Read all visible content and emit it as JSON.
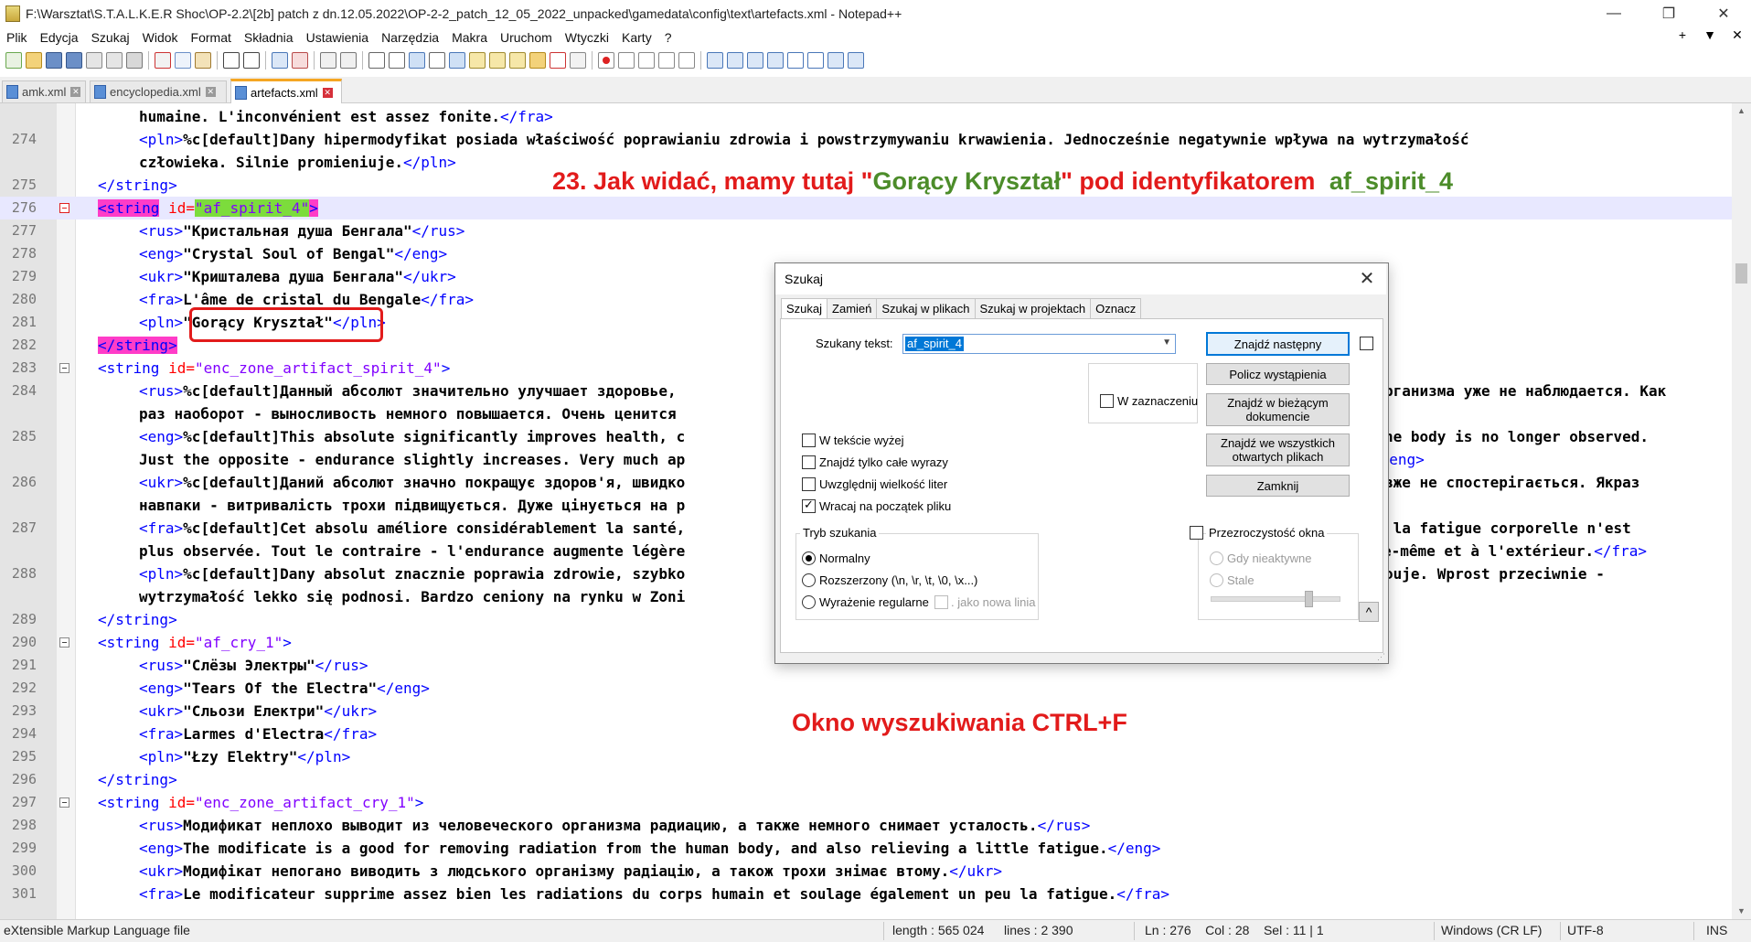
{
  "window": {
    "title": "F:\\Warsztat\\S.T.A.L.K.E.R Shoc\\OP-2.2\\[2b] patch z dn.12.05.2022\\OP-2-2_patch_12_05_2022_unpacked\\gamedata\\config\\text\\artefacts.xml - Notepad++",
    "minimize": "—",
    "maximize": "❐",
    "close": "✕"
  },
  "menu": {
    "items": [
      "Plik",
      "Edycja",
      "Szukaj",
      "Widok",
      "Format",
      "Składnia",
      "Ustawienia",
      "Narzędzia",
      "Makra",
      "Uruchom",
      "Wtyczki",
      "Karty",
      "?"
    ],
    "right": [
      "+",
      "▼",
      "✕"
    ]
  },
  "tabs": [
    {
      "label": "amk.xml",
      "active": false
    },
    {
      "label": "encyclopedia.xml",
      "active": false
    },
    {
      "label": "artefacts.xml",
      "active": true
    }
  ],
  "editor": {
    "lines": [
      {
        "n": "",
        "indent": 2,
        "parts": [
          [
            "txt",
            "humaine. L'inconvénient est assez fonite."
          ],
          [
            "tg",
            "</fra>"
          ]
        ]
      },
      {
        "n": "274",
        "indent": 2,
        "parts": [
          [
            "tg",
            "<pln>"
          ],
          [
            "txt",
            "%c[default]Dany hipermodyfikat posiada właściwość poprawianiu zdrowia i powstrzymywaniu krwawienia. Jednocześnie negatywnie wpływa na wytrzymałość"
          ]
        ]
      },
      {
        "n": "",
        "indent": 2,
        "parts": [
          [
            "txt",
            "człowieka. Silnie promieniuje."
          ],
          [
            "tg",
            "</pln>"
          ]
        ]
      },
      {
        "n": "275",
        "indent": 1,
        "parts": [
          [
            "tg",
            "</string>"
          ]
        ]
      },
      {
        "n": "276",
        "indent": 1,
        "hl": true,
        "parts": [
          [
            "tgx",
            "<string"
          ],
          [
            "at",
            " id="
          ],
          [
            "avx",
            "\"af_spirit_4\""
          ],
          [
            "tgx",
            ">"
          ]
        ]
      },
      {
        "n": "277",
        "indent": 2,
        "parts": [
          [
            "tg",
            "<rus>"
          ],
          [
            "txt",
            "\"Кристальная душа Бенгала\""
          ],
          [
            "tg",
            "</rus>"
          ]
        ]
      },
      {
        "n": "278",
        "indent": 2,
        "parts": [
          [
            "tg",
            "<eng>"
          ],
          [
            "txt",
            "\"Crystal Soul of Bengal\""
          ],
          [
            "tg",
            "</eng>"
          ]
        ]
      },
      {
        "n": "279",
        "indent": 2,
        "parts": [
          [
            "tg",
            "<ukr>"
          ],
          [
            "txt",
            "\"Кришталева душа Бенгала\""
          ],
          [
            "tg",
            "</ukr>"
          ]
        ]
      },
      {
        "n": "280",
        "indent": 2,
        "parts": [
          [
            "tg",
            "<fra>"
          ],
          [
            "txt",
            "L'âme de cristal du Bengale"
          ],
          [
            "tg",
            "</fra>"
          ]
        ]
      },
      {
        "n": "281",
        "indent": 2,
        "parts": [
          [
            "tg",
            "<pln>"
          ],
          [
            "txt",
            "\"Gorący Kryształ\""
          ],
          [
            "tg",
            "</pln>"
          ]
        ]
      },
      {
        "n": "282",
        "indent": 1,
        "parts": [
          [
            "tgx",
            "</string>"
          ]
        ]
      },
      {
        "n": "283",
        "indent": 1,
        "parts": [
          [
            "tg",
            "<string"
          ],
          [
            "at",
            " id="
          ],
          [
            "av",
            "\"enc_zone_artifact_spirit_4\""
          ],
          [
            "tg",
            ">"
          ]
        ]
      },
      {
        "n": "284",
        "indent": 2,
        "parts": [
          [
            "tg",
            "<rus>"
          ],
          [
            "txt",
            "%c[default]Данный абсолют значительно улучшает здоровье,"
          ]
        ]
      },
      {
        "n": "",
        "indent": 2,
        "parts": [
          [
            "txt",
            "раз наоборот - выносливость немного повышается. Очень ценится"
          ]
        ]
      },
      {
        "n": "285",
        "indent": 2,
        "parts": [
          [
            "tg",
            "<eng>"
          ],
          [
            "txt",
            "%c[default]This absolute significantly improves health, c"
          ]
        ]
      },
      {
        "n": "",
        "indent": 2,
        "parts": [
          [
            "txt",
            "Just the opposite - endurance slightly increases. Very much ap"
          ]
        ]
      },
      {
        "n": "286",
        "indent": 2,
        "parts": [
          [
            "tg",
            "<ukr>"
          ],
          [
            "txt",
            "%c[default]Даний абсолют значно покращує здоров'я, швидко"
          ]
        ]
      },
      {
        "n": "",
        "indent": 2,
        "parts": [
          [
            "txt",
            "навпаки - витривалість трохи підвищується. Дуже цінується на р"
          ]
        ]
      },
      {
        "n": "287",
        "indent": 2,
        "parts": [
          [
            "tg",
            "<fra>"
          ],
          [
            "txt",
            "%c[default]Cet absolu améliore considérablement la santé,"
          ]
        ]
      },
      {
        "n": "",
        "indent": 2,
        "parts": [
          [
            "txt",
            "plus observée. Tout le contraire - l'endurance augmente légère"
          ]
        ]
      },
      {
        "n": "288",
        "indent": 2,
        "parts": [
          [
            "tg",
            "<pln>"
          ],
          [
            "txt",
            "%c[default]Dany absolut znacznie poprawia zdrowie, szybko"
          ]
        ]
      },
      {
        "n": "",
        "indent": 2,
        "parts": [
          [
            "txt",
            "wytrzymałość lekko się podnosi. Bardzo ceniony na rynku w Zoni"
          ]
        ]
      },
      {
        "n": "289",
        "indent": 1,
        "parts": [
          [
            "tg",
            "</string>"
          ]
        ]
      },
      {
        "n": "290",
        "indent": 1,
        "parts": [
          [
            "tg",
            "<string"
          ],
          [
            "at",
            " id="
          ],
          [
            "av",
            "\"af_cry_1\""
          ],
          [
            "tg",
            ">"
          ]
        ]
      },
      {
        "n": "291",
        "indent": 2,
        "parts": [
          [
            "tg",
            "<rus>"
          ],
          [
            "txt",
            "\"Слёзы Электры\""
          ],
          [
            "tg",
            "</rus>"
          ]
        ]
      },
      {
        "n": "292",
        "indent": 2,
        "parts": [
          [
            "tg",
            "<eng>"
          ],
          [
            "txt",
            "\"Tears Of the Electra\""
          ],
          [
            "tg",
            "</eng>"
          ]
        ]
      },
      {
        "n": "293",
        "indent": 2,
        "parts": [
          [
            "tg",
            "<ukr>"
          ],
          [
            "txt",
            "\"Сльози Електри\""
          ],
          [
            "tg",
            "</ukr>"
          ]
        ]
      },
      {
        "n": "294",
        "indent": 2,
        "parts": [
          [
            "tg",
            "<fra>"
          ],
          [
            "txt",
            "Larmes d'Electra"
          ],
          [
            "tg",
            "</fra>"
          ]
        ]
      },
      {
        "n": "295",
        "indent": 2,
        "parts": [
          [
            "tg",
            "<pln>"
          ],
          [
            "txt",
            "\"Łzy Elektry\""
          ],
          [
            "tg",
            "</pln>"
          ]
        ]
      },
      {
        "n": "296",
        "indent": 1,
        "parts": [
          [
            "tg",
            "</string>"
          ]
        ]
      },
      {
        "n": "297",
        "indent": 1,
        "parts": [
          [
            "tg",
            "<string"
          ],
          [
            "at",
            " id="
          ],
          [
            "av",
            "\"enc_zone_artifact_cry_1\""
          ],
          [
            "tg",
            ">"
          ]
        ]
      },
      {
        "n": "298",
        "indent": 2,
        "parts": [
          [
            "tg",
            "<rus>"
          ],
          [
            "txt",
            "Модификат неплохо выводит из человеческого организма радиацию, а также немного снимает усталость."
          ],
          [
            "tg",
            "</rus>"
          ]
        ]
      },
      {
        "n": "299",
        "indent": 2,
        "parts": [
          [
            "tg",
            "<eng>"
          ],
          [
            "txt",
            "The modificate is a good for removing radiation from the human body, and also relieving a little fatigue."
          ],
          [
            "tg",
            "</eng>"
          ]
        ]
      },
      {
        "n": "300",
        "indent": 2,
        "parts": [
          [
            "tg",
            "<ukr>"
          ],
          [
            "txt",
            "Модифікат непогано виводить з людського організму радіацію, а також трохи знімає втому."
          ],
          [
            "tg",
            "</ukr>"
          ]
        ]
      },
      {
        "n": "301",
        "indent": 2,
        "parts": [
          [
            "tg",
            "<fra>"
          ],
          [
            "txt",
            "Le modificateur supprime assez bien les radiations du corps humain et soulage également un peu la fatigue."
          ],
          [
            "tg",
            "</fra>"
          ]
        ]
      }
    ],
    "right_fragments": [
      {
        "row": 12,
        "parts": [
          [
            "txt",
            "рганизма уже не наблюдается. Как"
          ]
        ]
      },
      {
        "row": 14,
        "parts": [
          [
            "txt",
            "he body is no longer observed."
          ]
        ]
      },
      {
        "row": 15,
        "parts": [
          [
            "tg",
            "</eng>"
          ]
        ]
      },
      {
        "row": 16,
        "parts": [
          [
            "txt",
            "вже не спостерігається. Якраз"
          ]
        ]
      },
      {
        "row": 18,
        "parts": [
          [
            "txt",
            " la fatigue corporelle n'est"
          ]
        ]
      },
      {
        "row": 19,
        "parts": [
          [
            "txt",
            "e-même et à l'extérieur."
          ],
          [
            "tg",
            "</fra>"
          ]
        ]
      },
      {
        "row": 20,
        "parts": [
          [
            "txt",
            "ouje. Wprost przeciwnie -"
          ]
        ]
      }
    ]
  },
  "annotations": {
    "heading_pre": "23. Jak widać, mamy tutaj \"",
    "heading_green": "Gorący Kryształ",
    "heading_mid": "\" pod identyfikatorem ",
    "heading_id": "af_spirit_4",
    "ctrl_f": "Okno wyszukiwania CTRL+F"
  },
  "dialog": {
    "title": "Szukaj",
    "close": "✕",
    "tabs": [
      "Szukaj",
      "Zamień",
      "Szukaj w plikach",
      "Szukaj w projektach",
      "Oznacz"
    ],
    "search_label": "Szukany tekst:",
    "search_value": "af_spirit_4",
    "btn_find_next": "Znajdź następny",
    "btn_count": "Policz wystąpienia",
    "btn_find_current_1": "Znajdź w bieżącym",
    "btn_find_current_2": "dokumencie",
    "btn_find_all_open_1": "Znajdź we wszystkich",
    "btn_find_all_open_2": "otwartych plikach",
    "btn_close": "Zamknij",
    "in_selection": "W zaznaczeniu",
    "options": [
      {
        "label": "W tekście wyżej",
        "checked": false
      },
      {
        "label": "Znajdź tylko całe wyrazy",
        "checked": false
      },
      {
        "label": "Uwzględnij wielkość liter",
        "checked": false
      },
      {
        "label": "Wracaj na początek pliku",
        "checked": true
      }
    ],
    "mode_title": "Tryb szukania",
    "modes": [
      {
        "label": "Normalny",
        "checked": true
      },
      {
        "label": "Rozszerzony (\\n, \\r, \\t, \\0, \\x...)",
        "checked": false
      },
      {
        "label": "Wyrażenie regularne",
        "checked": false
      }
    ],
    "dot_newline": ". jako nowa linia",
    "transparency_title": "Przezroczystość okna",
    "transparency_opts": [
      "Gdy nieaktywne",
      "Stale"
    ],
    "transparency_level": 0.76,
    "collapse": "^"
  },
  "status": {
    "filetype": "eXtensible Markup Language file",
    "length": "length : 565 024",
    "lines": "lines : 2 390",
    "position": "Ln : 276    Col : 28    Sel : 11 | 1",
    "eol": "Windows (CR LF)",
    "encoding": "UTF-8",
    "mode": "INS"
  },
  "colors": {
    "tag": "#0000ff",
    "attr": "#ff0000",
    "attr_value": "#8000ff",
    "accent_red": "#e21b1b",
    "accent_green": "#4c8c2a"
  }
}
